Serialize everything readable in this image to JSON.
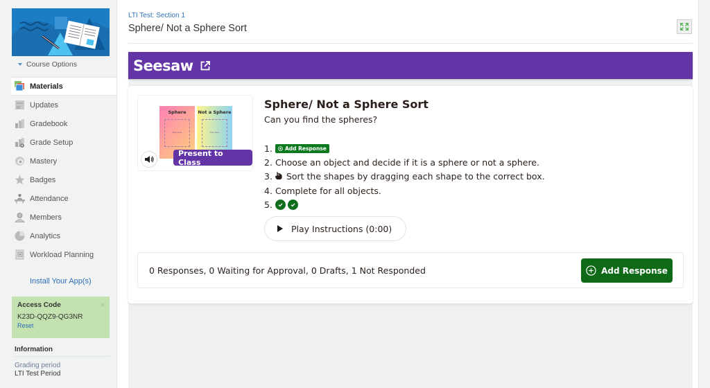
{
  "sidebar": {
    "course_options_label": "Course Options",
    "nav": [
      {
        "label": "Materials",
        "icon": "materials-icon",
        "active": true
      },
      {
        "label": "Updates",
        "icon": "updates-icon"
      },
      {
        "label": "Gradebook",
        "icon": "gradebook-icon"
      },
      {
        "label": "Grade Setup",
        "icon": "grade-setup-icon"
      },
      {
        "label": "Mastery",
        "icon": "mastery-icon"
      },
      {
        "label": "Badges",
        "icon": "badges-icon"
      },
      {
        "label": "Attendance",
        "icon": "attendance-icon"
      },
      {
        "label": "Members",
        "icon": "members-icon"
      },
      {
        "label": "Analytics",
        "icon": "analytics-icon"
      },
      {
        "label": "Workload Planning",
        "icon": "workload-planning-icon"
      }
    ],
    "install_apps_label": "Install Your App(s)",
    "access_code": {
      "title": "Access Code",
      "code": "K23D-QQZ9-QG3NR",
      "reset_label": "Reset",
      "close_glyph": "×"
    },
    "information": {
      "title": "Information",
      "grading_period_label": "Grading period",
      "grading_period_value": "LTI Test Period"
    }
  },
  "header": {
    "breadcrumb": "LTI Test: Section 1",
    "title": "Sphere/ Not a Sphere Sort"
  },
  "seesaw": {
    "logo_text": "Seesaw",
    "brand_color": "#6334a6",
    "activity": {
      "title": "Sphere/ Not a Sphere Sort",
      "subtitle": "Can you find the spheres?",
      "thumbnail": {
        "page1_title": "Sphere",
        "page2_title": "Not a Sphere",
        "drop_label": "Drop Here"
      },
      "present_label": "Present to Class",
      "steps": [
        {
          "num": "1.",
          "inline_button": "Add Response"
        },
        {
          "num": "2.",
          "text": "Choose an object and decide if it is a sphere or not a sphere."
        },
        {
          "num": "3.",
          "text": "Sort the shapes by dragging each shape to the correct box.",
          "icon": "hand-drag-icon"
        },
        {
          "num": "4.",
          "text": "Complete for all objects."
        },
        {
          "num": "5.",
          "checks": 2
        }
      ],
      "play_label": "Play Instructions (0:00)"
    },
    "responses": {
      "summary": "0 Responses, 0 Waiting for Approval, 0 Drafts, 1 Not Responded",
      "add_response_label": "Add Response",
      "button_color": "#0e6a17"
    }
  }
}
